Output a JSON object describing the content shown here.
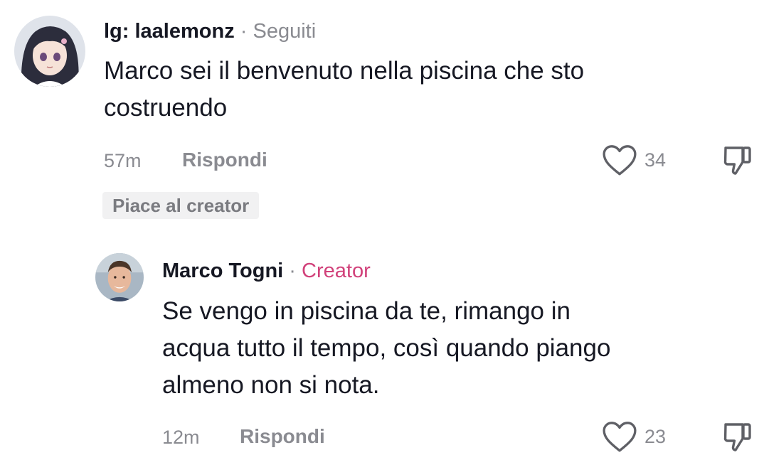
{
  "comments": [
    {
      "username": "lg: laalemonz",
      "separator": "·",
      "tag": "Seguiti",
      "text_lines": [
        "Marco sei il benvenuto nella piscina che sto",
        "costruendo"
      ],
      "time": "57m",
      "reply_label": "Rispondi",
      "likes": "34",
      "creator_liked_label": "Piace al creator",
      "avatar_icon": "anime-girl-avatar"
    },
    {
      "username": "Marco Togni",
      "separator": "·",
      "tag": "Creator",
      "text_lines": [
        "Se vengo in piscina da te, rimango in",
        "acqua tutto il tempo, così quando piango",
        "almeno non si nota."
      ],
      "time": "12m",
      "reply_label": "Rispondi",
      "likes": "23",
      "avatar_icon": "man-avatar"
    }
  ],
  "colors": {
    "text": "#161823",
    "muted": "#8a8b91",
    "creator_tag": "#d1417a",
    "badge_bg": "#f1f1f2"
  }
}
